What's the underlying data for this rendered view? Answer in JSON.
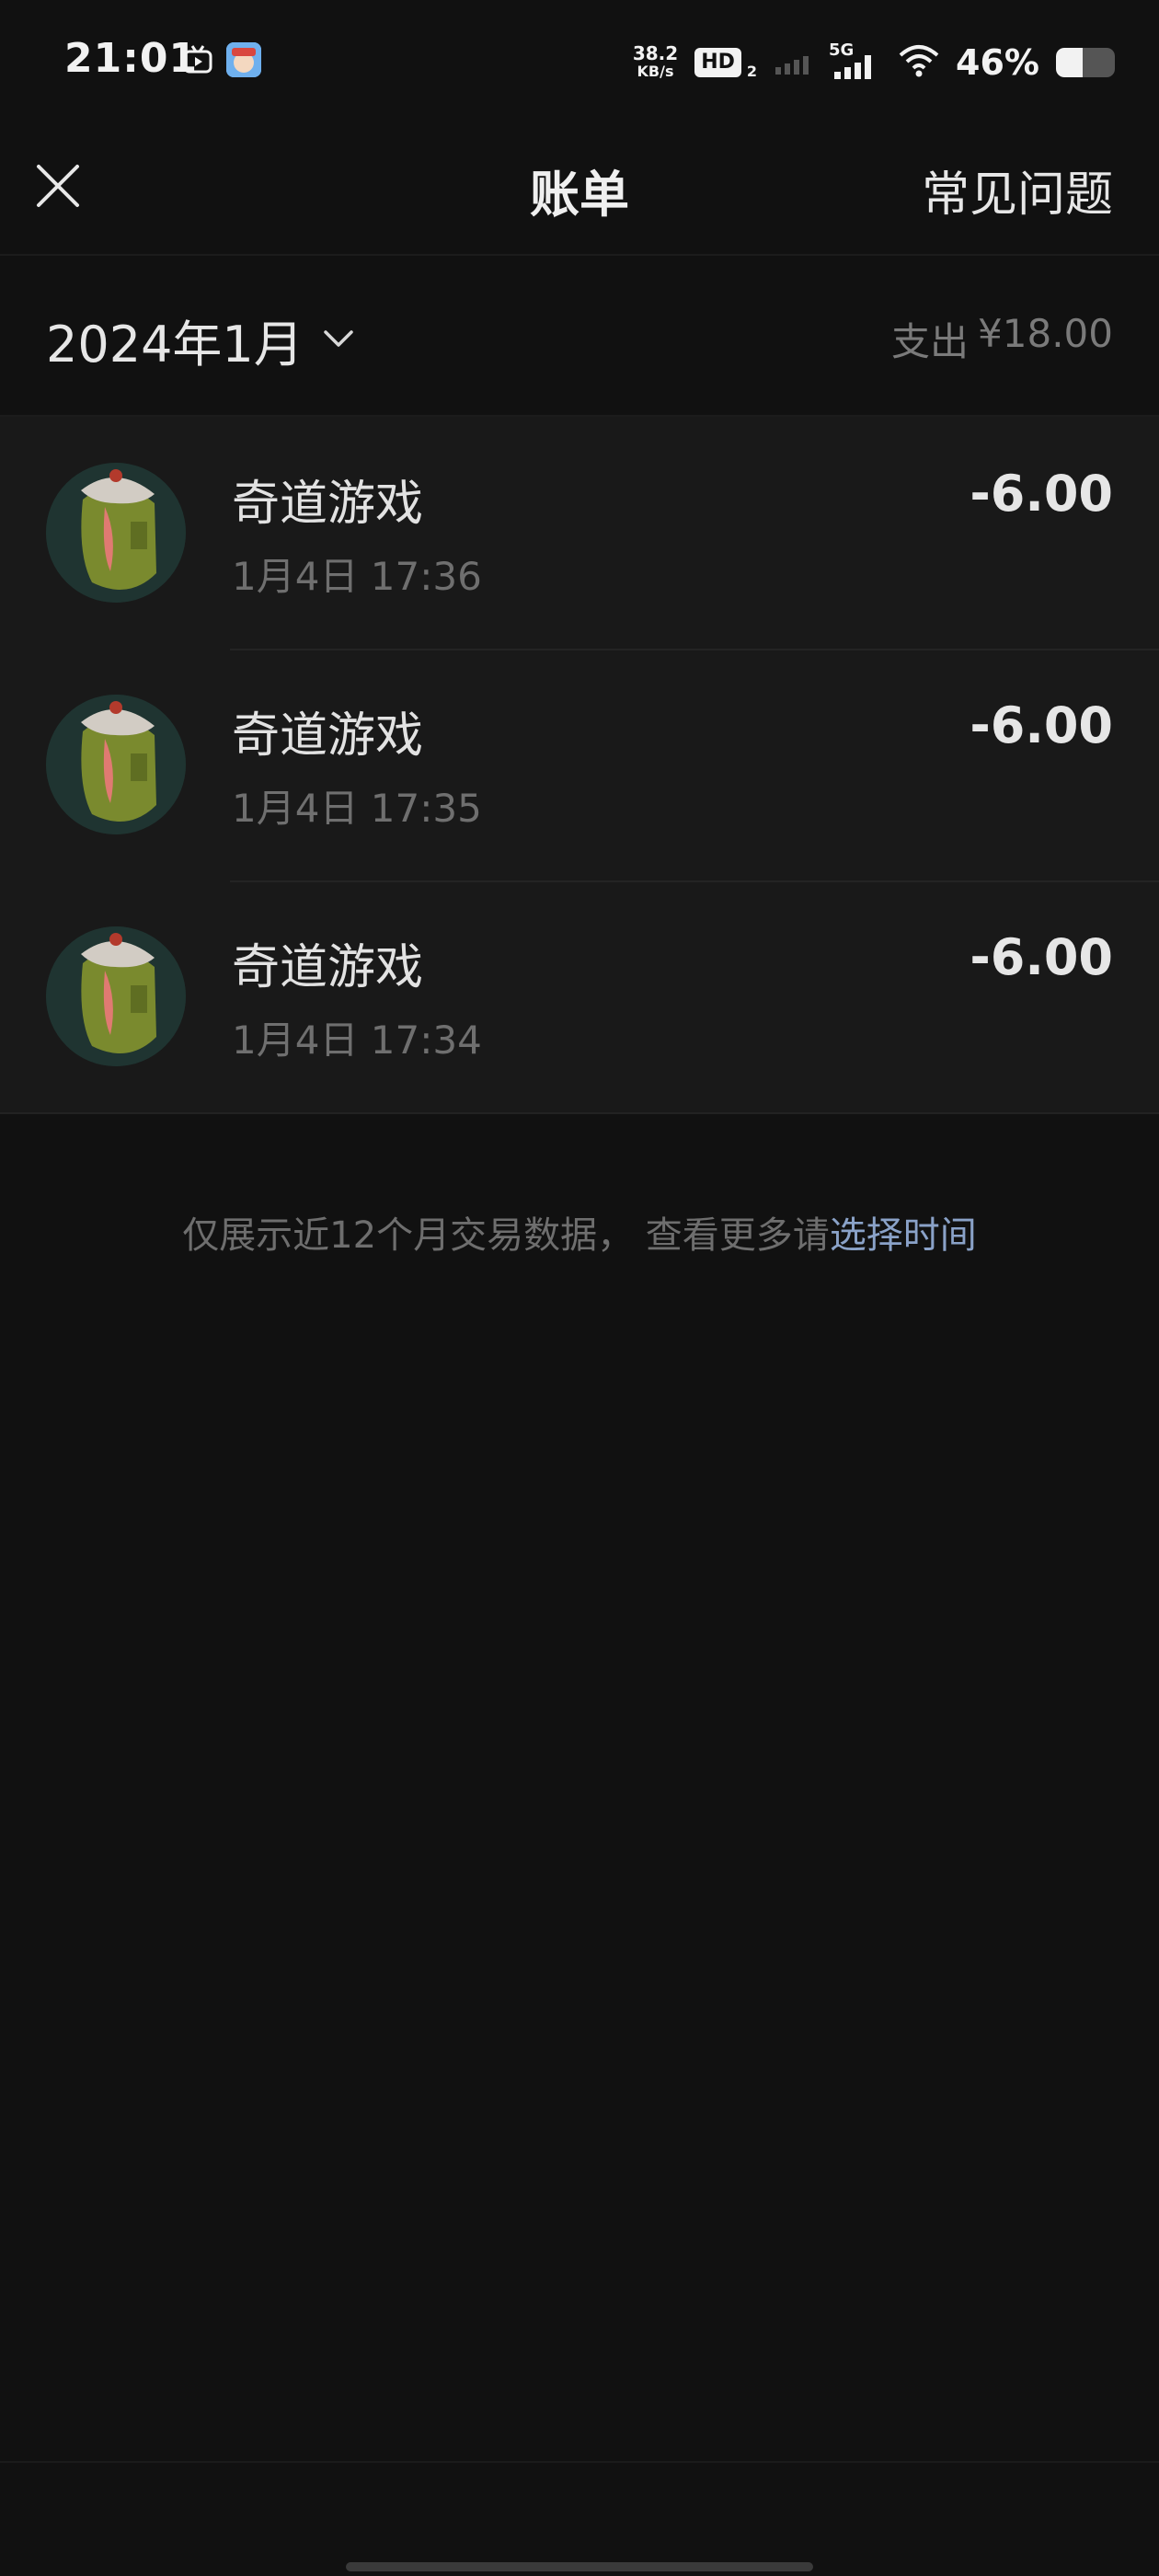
{
  "status_bar": {
    "time": "21:01",
    "net_speed_value": "38.2",
    "net_speed_unit": "KB/s",
    "hd_label": "HD",
    "hd_sub": "2",
    "network_type": "5G",
    "battery_percent": "46%",
    "battery_level": 0.46
  },
  "nav": {
    "title": "账单",
    "faq_label": "常见问题",
    "close_icon": "close-icon"
  },
  "month": {
    "label": "2024年1月",
    "total_label": "支出",
    "total_value": "¥18.00"
  },
  "transactions": [
    {
      "name": "奇道游戏",
      "time": "1月4日 17:36",
      "amount": "-6.00"
    },
    {
      "name": "奇道游戏",
      "time": "1月4日 17:35",
      "amount": "-6.00"
    },
    {
      "name": "奇道游戏",
      "time": "1月4日 17:34",
      "amount": "-6.00"
    }
  ],
  "footer": {
    "note": "仅展示近12个月交易数据， 查看更多请",
    "link": "选择时间"
  }
}
